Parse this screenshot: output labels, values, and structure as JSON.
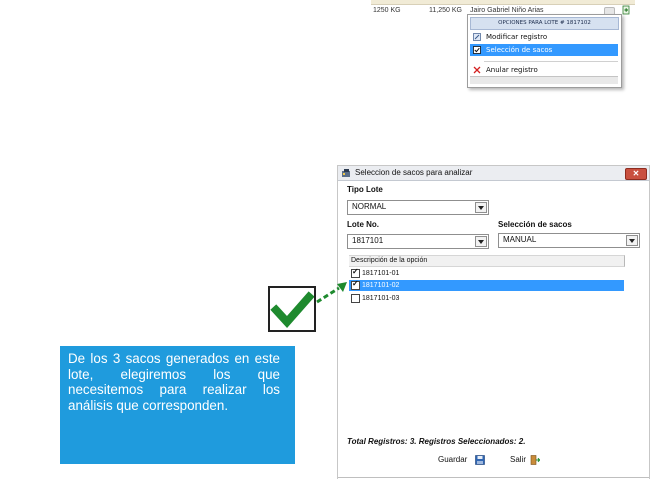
{
  "top_row": {
    "weight": "1250 KG",
    "total": "11,250 KG",
    "person": "Jairo Gabriel Niño Arias"
  },
  "context_menu": {
    "title": "OPCIONES PARA LOTE # 1817102",
    "items": [
      {
        "label": "Modificar registro",
        "icon": "edit-icon",
        "selected": false
      },
      {
        "label": "Selección de sacos",
        "icon": "checkbox-icon",
        "selected": true
      },
      {
        "label": "Anular registro",
        "icon": "cancel-x-icon",
        "selected": false
      }
    ]
  },
  "dialog": {
    "title": "Seleccion de sacos para analizar",
    "tipo_lote_label": "Tipo Lote",
    "tipo_lote_value": "NORMAL",
    "lote_no_label": "Lote No.",
    "lote_no_value": "1817101",
    "seleccion_label": "Selección de sacos",
    "seleccion_value": "MANUAL",
    "list_header": "Descripción de la opción",
    "items": [
      {
        "label": "1817101-01",
        "checked": true,
        "selected": false
      },
      {
        "label": "1817101-02",
        "checked": true,
        "selected": true
      },
      {
        "label": "1817101-03",
        "checked": false,
        "selected": false
      }
    ],
    "totals": "Total Registros: 3. Registros Seleccionados: 2.",
    "save_label": "Guardar",
    "exit_label": "Salir"
  },
  "callout": {
    "text": "De los 3 sacos generados en este lote, elegiremos los que necesitemos para realizar los análisis que corresponden."
  },
  "colors": {
    "selection": "#3399ff",
    "callout_bg": "#1f9bdd",
    "check_green": "#1e8a2e",
    "close_red": "#c9503f"
  }
}
